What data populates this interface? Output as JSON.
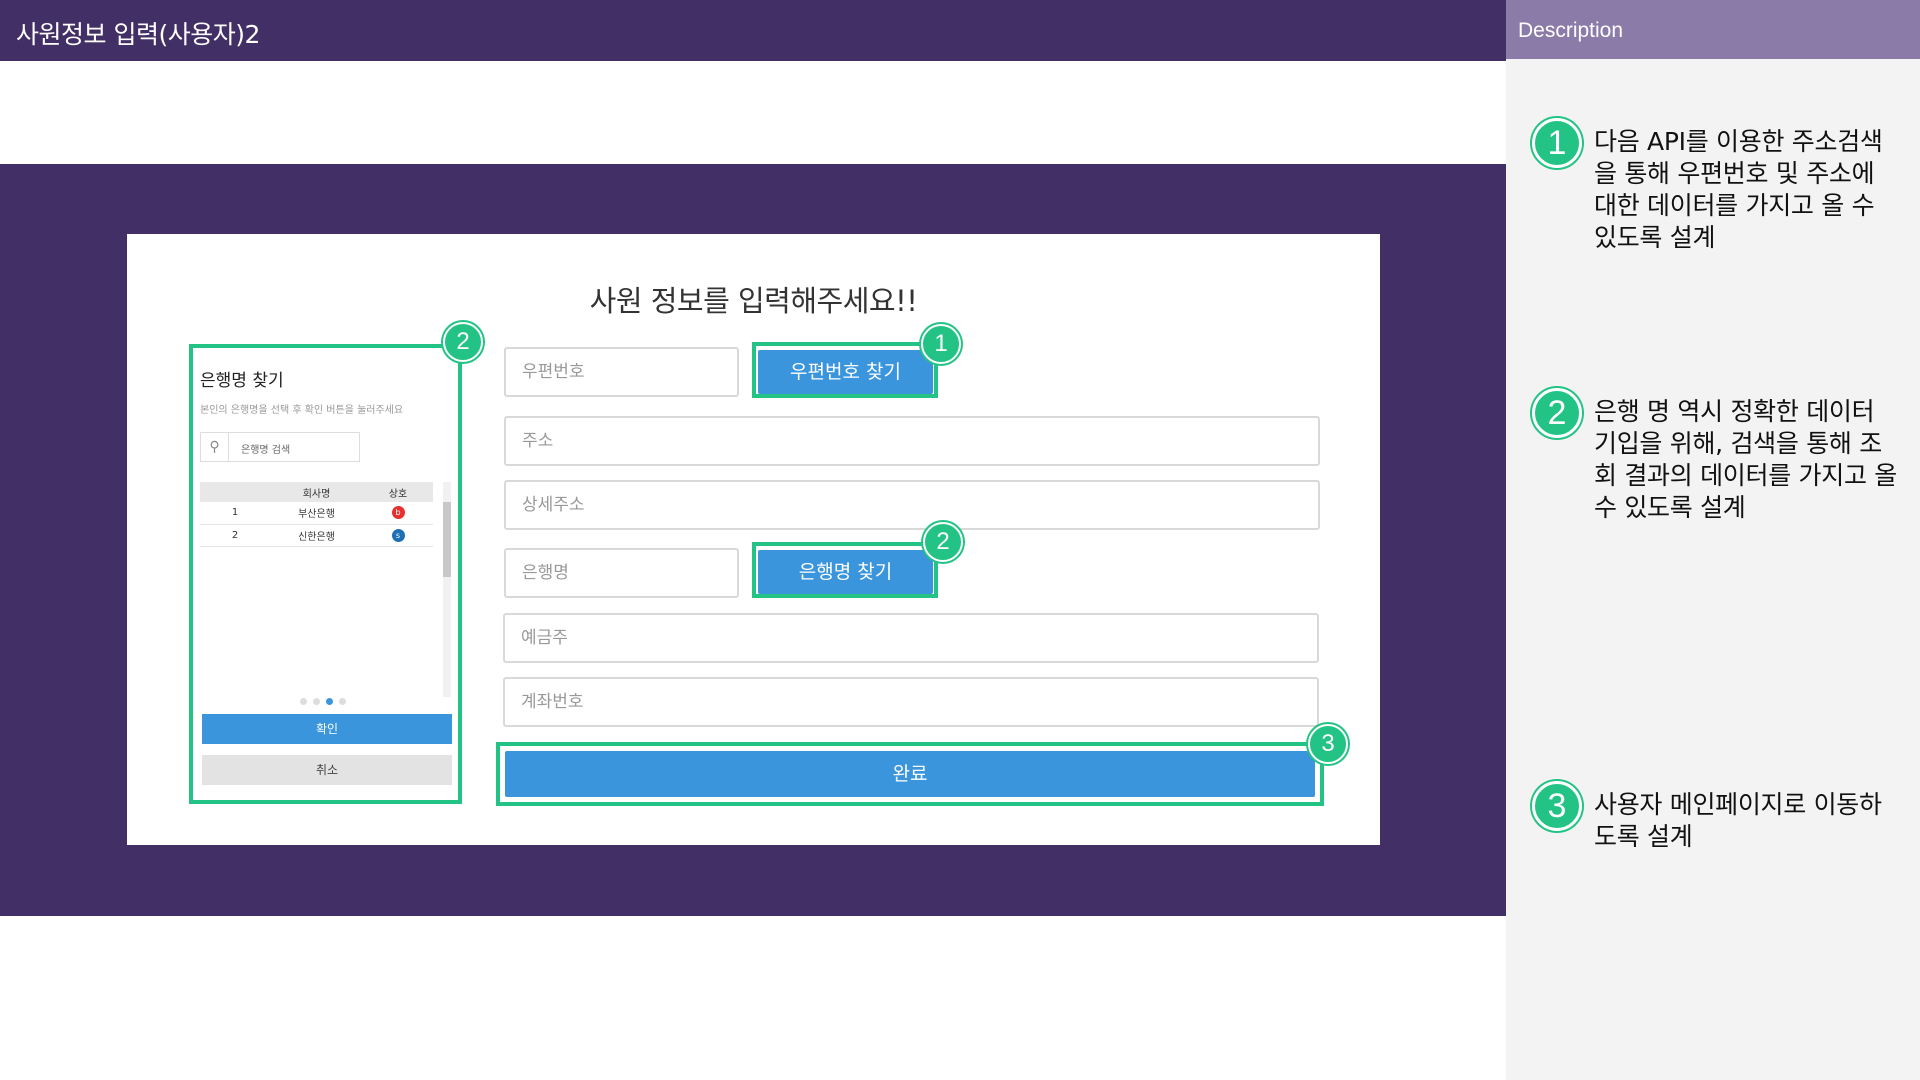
{
  "header": {
    "title": "사원정보 입력(사용자)2"
  },
  "description": {
    "heading": "Description",
    "items": [
      {
        "num": "1",
        "text": "다음 API를 이용한 주소검색을 통해  우편번호 및 주소에 대한 데이터를 가지고 올 수 있도록 설계"
      },
      {
        "num": "2",
        "text": "은행 명 역시 정확한 데이터 기입을 위해, 검색을 통해 조회 결과의 데이터를 가지고 올 수 있도록 설계"
      },
      {
        "num": "3",
        "text": "사용자 메인페이지로 이동하도록 설계"
      }
    ]
  },
  "form": {
    "title": "사원 정보를 입력해주세요!!",
    "zipcode_placeholder": "우편번호",
    "zipcode_button": "우편번호 찾기",
    "address_placeholder": "주소",
    "detail_address_placeholder": "상세주소",
    "bank_placeholder": "은행명",
    "bank_button": "은행명 찾기",
    "holder_placeholder": "예금주",
    "account_placeholder": "계좌번호",
    "submit": "완료"
  },
  "badges": {
    "one": "1",
    "two": "2",
    "three": "3"
  },
  "bank_modal": {
    "title": "은행명 찾기",
    "subtitle": "본인의 은행명을 선택 후 확인 버튼을 눌러주세요",
    "search_placeholder": "은행명 검색",
    "columns": [
      "회사명",
      "상호"
    ],
    "rows": [
      {
        "no": "1",
        "name": "부산은행",
        "logo_color": "#e5302f"
      },
      {
        "no": "2",
        "name": "신한은행",
        "logo_color": "#1e6fb5"
      }
    ],
    "ok": "확인",
    "cancel": "취소"
  },
  "colors": {
    "purple": "#422f65",
    "accent_green": "#22c384",
    "button_blue": "#3a95dd"
  }
}
